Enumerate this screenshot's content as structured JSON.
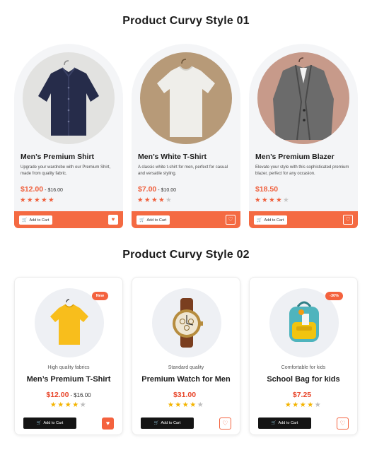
{
  "section1": {
    "title": "Product Curvy Style 01",
    "cards": [
      {
        "name": "Men’s Premium Shirt",
        "desc": "Upgrade your wardrobe with our Premium Shirt, made from quality fabric.",
        "price": "$12.00",
        "sep": "-",
        "old_price": "$16.00",
        "rating": 5,
        "wishlisted": true,
        "cart_label": "Add to Cart"
      },
      {
        "name": "Men’s White T-Shirt",
        "desc": "A classic white t-shirt for men, perfect for casual and versatile styling.",
        "price": "$7.00",
        "sep": "-",
        "old_price": "$10.00",
        "rating": 4,
        "wishlisted": false,
        "cart_label": "Add to Cart"
      },
      {
        "name": "Men’s Premium Blazer",
        "desc": "Elevate your style with this sophisticated premium blazer, perfect for any occasion.",
        "price": "$18.50",
        "sep": "",
        "old_price": "",
        "rating": 4,
        "wishlisted": false,
        "cart_label": "Add to Cart"
      }
    ]
  },
  "section2": {
    "title": "Product Curvy Style 02",
    "cards": [
      {
        "badge": "New",
        "subtitle": "High quality fabrics",
        "name": "Men’s Premium T-Shirt",
        "price": "$12.00",
        "sep": "-",
        "old_price": "$16.00",
        "rating": 4,
        "wishlisted": true,
        "cart_label": "Add to Cart"
      },
      {
        "badge": "",
        "subtitle": "Standard quality",
        "name": "Premium Watch for Men",
        "price": "$31.00",
        "sep": "",
        "old_price": "",
        "rating": 4,
        "wishlisted": false,
        "cart_label": "Add to Cart"
      },
      {
        "badge": "-30%",
        "subtitle": "Comfortable for kids",
        "name": "School Bag for kids",
        "price": "$7.25",
        "sep": "",
        "old_price": "",
        "rating": 4,
        "wishlisted": false,
        "cart_label": "Add to Cart"
      }
    ]
  },
  "colors": {
    "accent": "#f46a42",
    "star_gold": "#f4b400",
    "star_off": "#c6c6c6",
    "card_bg": "#f4f5f7",
    "dark_button": "#141414"
  },
  "icons": {
    "cart": "cart-icon",
    "heart": "heart-icon",
    "star": "star-icon"
  }
}
